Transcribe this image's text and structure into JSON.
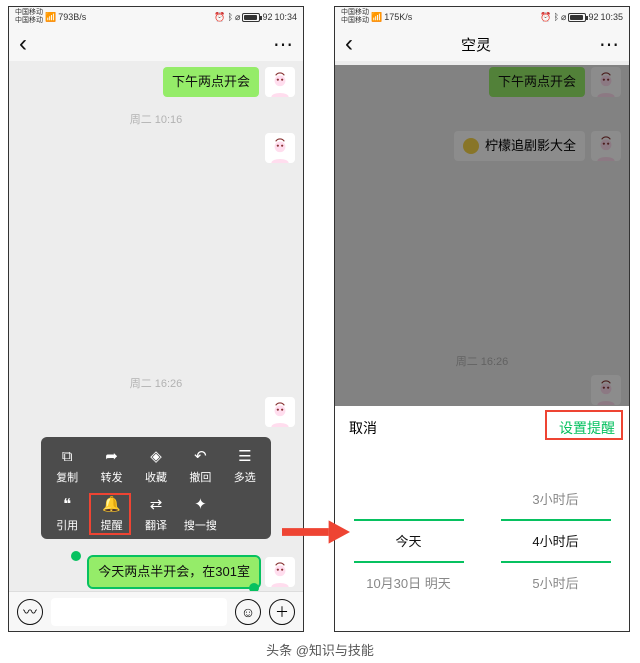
{
  "left": {
    "status": {
      "carrier1": "中国移动",
      "carrier2": "中国移动",
      "net": "793B/s",
      "time": "10:34",
      "battery": "92"
    },
    "nav": {
      "title": ""
    },
    "msg_top": "下午两点开会",
    "ts1": "周二 10:16",
    "ts2": "周二 16:26",
    "msg_sel": "今天两点半开会，在301室",
    "ctx": {
      "copy": "复制",
      "forward": "转发",
      "fav": "收藏",
      "recall": "撤回",
      "multi": "多选",
      "quote": "引用",
      "remind": "提醒",
      "translate": "翻译",
      "search": "搜一搜"
    }
  },
  "right": {
    "status": {
      "carrier1": "中国移动",
      "carrier2": "中国移动",
      "net": "175K/s",
      "time": "10:35",
      "battery": "92"
    },
    "nav": {
      "title": "空灵"
    },
    "msg_top": "下午两点开会",
    "card": "柠檬追剧影大全",
    "ts2": "周二 16:26",
    "sheet": {
      "cancel": "取消",
      "ok": "设置提醒",
      "left_opts": [
        "",
        "今天",
        "10月30日 明天"
      ],
      "right_opts": [
        "3小时后",
        "4小时后",
        "5小时后"
      ],
      "left_sel": 1,
      "right_sel": 1
    }
  },
  "credit_prefix": "头条 @",
  "credit_author": "知识与技能"
}
